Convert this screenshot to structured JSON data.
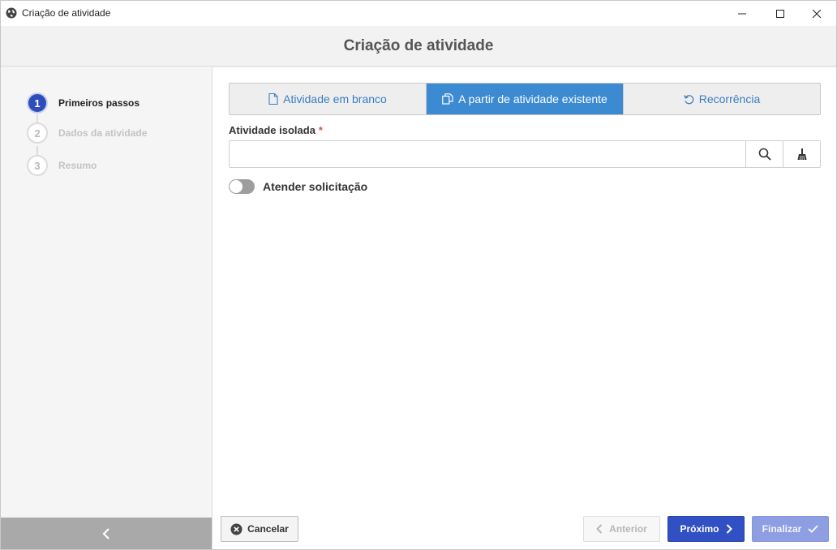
{
  "window": {
    "title": "Criação de atividade",
    "icon": "globe-icon"
  },
  "header": {
    "title": "Criação de atividade"
  },
  "steps": [
    {
      "number": "1",
      "label": "Primeiros passos",
      "state": "active"
    },
    {
      "number": "2",
      "label": "Dados da atividade",
      "state": "inactive"
    },
    {
      "number": "3",
      "label": "Resumo",
      "state": "inactive"
    }
  ],
  "tabs": [
    {
      "label": "Atividade em branco",
      "icon": "document-icon",
      "active": false
    },
    {
      "label": "A partir de atividade existente",
      "icon": "copy-icon",
      "active": true
    },
    {
      "label": "Recorrência",
      "icon": "refresh-icon",
      "active": false
    }
  ],
  "field": {
    "label": "Atividade isolada",
    "required_mark": "*",
    "value": "",
    "placeholder": ""
  },
  "toggle": {
    "label": "Atender solicitação",
    "on": false
  },
  "footer": {
    "cancel_label": "Cancelar",
    "prev_label": "Anterior",
    "next_label": "Próximo",
    "finish_label": "Finalizar"
  },
  "colors": {
    "accent": "#3050c4",
    "tab_active": "#3b8ad2",
    "step_active": "#2d4dbb",
    "required": "#d9534f"
  }
}
